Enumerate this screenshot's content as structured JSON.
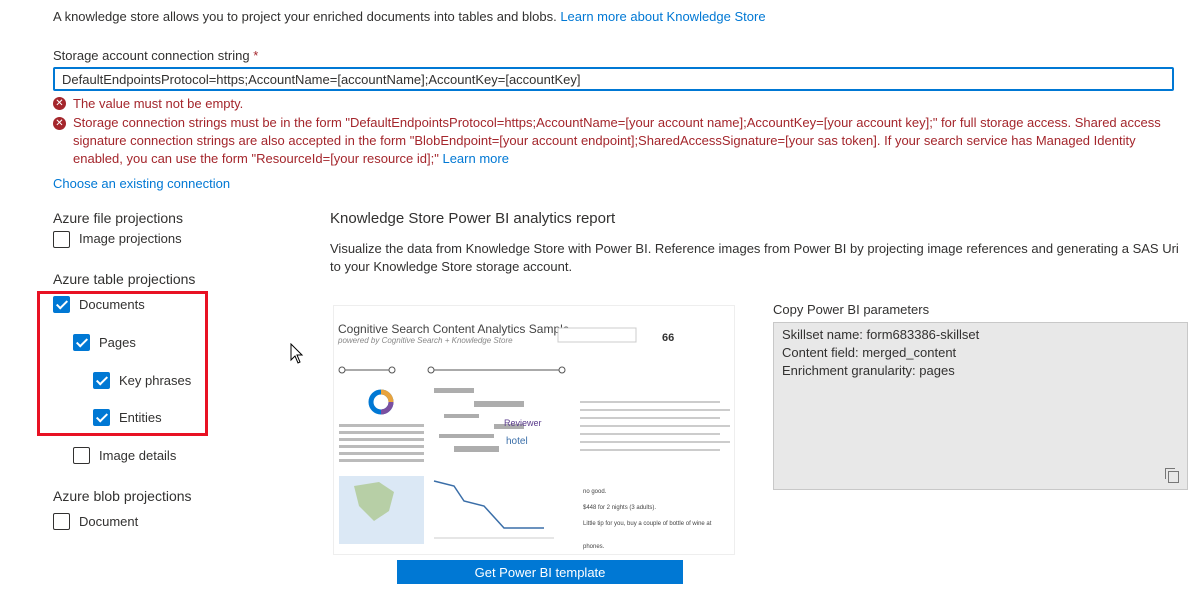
{
  "intro": {
    "text": "A knowledge store allows you to project your enriched documents into tables and blobs. ",
    "link": "Learn more about Knowledge Store"
  },
  "connection": {
    "label": "Storage account connection string",
    "required_mark": " *",
    "value": "DefaultEndpointsProtocol=https;AccountName=[accountName];AccountKey=[accountKey]"
  },
  "errors": {
    "empty": "The value must not be empty.",
    "format": "Storage connection strings must be in the form \"DefaultEndpointsProtocol=https;AccountName=[your account name];AccountKey=[your account key];\" for full storage access. Shared access signature connection strings are also accepted in the form \"BlobEndpoint=[your account endpoint];SharedAccessSignature=[your sas token]. If your search service has Managed Identity enabled, you can use the form \"ResourceId=[your resource id];\" ",
    "learn_more": "Learn more"
  },
  "choose_existing": "Choose an existing connection",
  "file_projections": {
    "heading": "Azure file projections",
    "items": [
      {
        "label": "Image projections",
        "checked": false
      }
    ]
  },
  "table_projections": {
    "heading": "Azure table projections",
    "items": [
      {
        "label": "Documents",
        "checked": true
      },
      {
        "label": "Pages",
        "checked": true
      },
      {
        "label": "Key phrases",
        "checked": true
      },
      {
        "label": "Entities",
        "checked": true
      },
      {
        "label": "Image details",
        "checked": false
      }
    ]
  },
  "blob_projections": {
    "heading": "Azure blob projections",
    "items": [
      {
        "label": "Document",
        "checked": false
      }
    ]
  },
  "report": {
    "title": "Knowledge Store Power BI analytics report",
    "description": "Visualize the data from Knowledge Store with Power BI. Reference images from Power BI by projecting image references and generating a SAS Uri to your Knowledge Store storage account.",
    "preview": {
      "title": "Cognitive Search Content Analytics Sample",
      "subtitle": "powered by Cognitive Search + Knowledge Store",
      "count": "66"
    },
    "button": "Get Power BI template"
  },
  "params": {
    "label": "Copy Power BI parameters",
    "lines": [
      "Skillset name: form683386-skillset",
      "Content field: merged_content",
      "Enrichment granularity: pages"
    ]
  },
  "colors": {
    "accent": "#0078d4",
    "error": "#a4262c",
    "highlight": "#e81123"
  }
}
